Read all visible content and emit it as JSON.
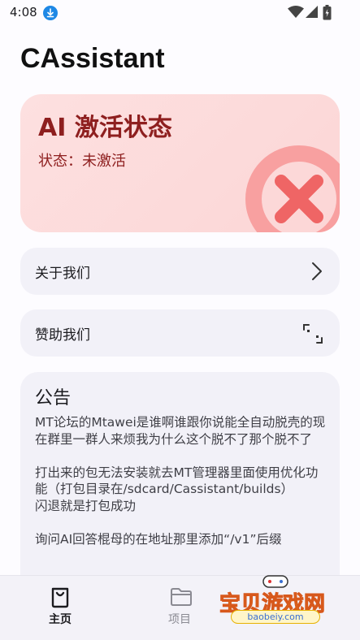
{
  "status_bar": {
    "time": "4:08"
  },
  "header": {
    "title": "CAssistant"
  },
  "activation": {
    "title": "AI 激活状态",
    "status": "状态：未激活",
    "color": "#8e1f1f",
    "icon": "close-circle-icon"
  },
  "menu": {
    "about": {
      "label": "关于我们",
      "icon": "chevron-right-icon"
    },
    "sponsor": {
      "label": "赞助我们",
      "icon": "scan-icon"
    }
  },
  "notice": {
    "title": "公告",
    "body": "MT论坛的Mtawei是谁啊谁跟你说能全自动脱壳的现在群里一群人来烦我为什么这个脱不了那个脱不了\n\n打出来的包无法安装就去MT管理器里面使用优化功能（打包目录在/sdcard/Cassistant/builds）\n闪退就是打包成功\n\n询问AI回答棍母的在地址那里添加“/v1”后缀"
  },
  "bottom_nav": {
    "items": [
      {
        "label": "主页",
        "icon": "home-bag-icon",
        "active": true
      },
      {
        "label": "项目",
        "icon": "folder-icon",
        "active": false
      }
    ]
  },
  "watermark": {
    "text": "宝贝游戏网",
    "url": "baobeiy.com"
  }
}
